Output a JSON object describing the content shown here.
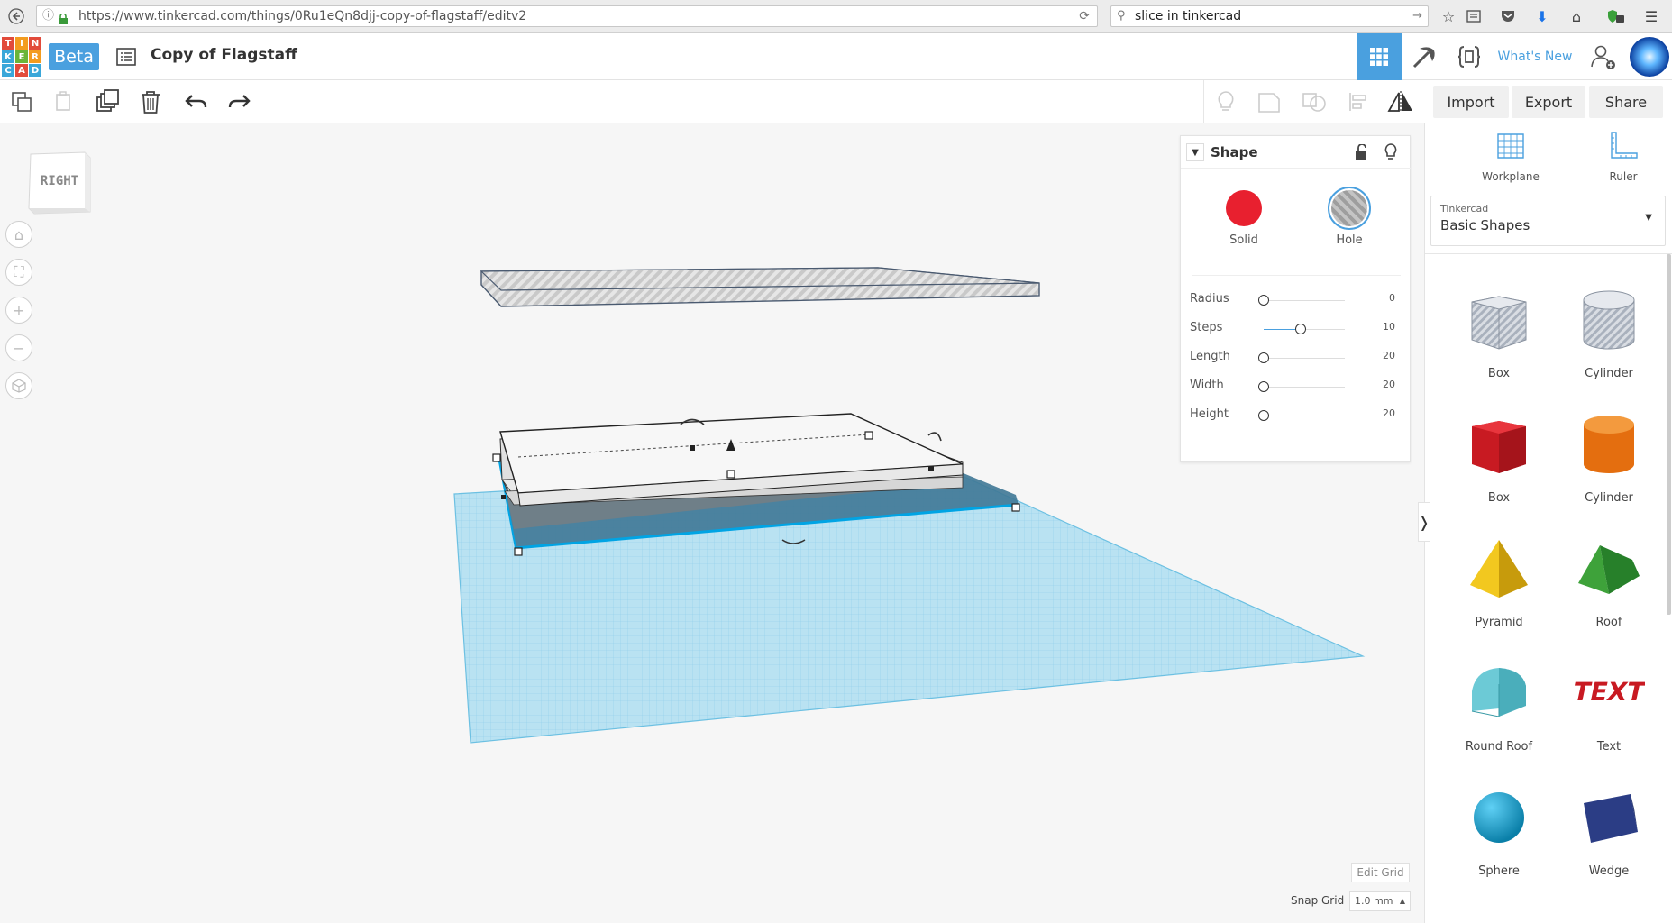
{
  "browser": {
    "url": "https://www.tinkercad.com/things/0Ru1eQn8djj-copy-of-flagstaff/editv2",
    "search": "slice in tinkercad"
  },
  "header": {
    "logo_letters": [
      "T",
      "I",
      "N",
      "K",
      "E",
      "R",
      "C",
      "A",
      "D"
    ],
    "beta_label": "Beta",
    "design_title": "Copy of Flagstaff",
    "whats_new": "What's New"
  },
  "toolbar": {
    "import_label": "Import",
    "export_label": "Export",
    "share_label": "Share"
  },
  "view_cube": {
    "label": "RIGHT"
  },
  "shape_panel": {
    "title": "Shape",
    "solid_label": "Solid",
    "hole_label": "Hole",
    "solid_color": "#e8202f",
    "properties": [
      {
        "label": "Radius",
        "value": "0",
        "level": 0.0
      },
      {
        "label": "Steps",
        "value": "10",
        "level": 0.45
      },
      {
        "label": "Length",
        "value": "20",
        "level": 0.0
      },
      {
        "label": "Width",
        "value": "20",
        "level": 0.0
      },
      {
        "label": "Height",
        "value": "20",
        "level": 0.0
      }
    ]
  },
  "right_panel": {
    "workplane_label": "Workplane",
    "ruler_label": "Ruler",
    "library_source": "Tinkercad",
    "library_name": "Basic Shapes",
    "shapes": [
      {
        "label": "Box",
        "icon": "box-hole-icon"
      },
      {
        "label": "Cylinder",
        "icon": "cylinder-hole-icon"
      },
      {
        "label": "Box",
        "icon": "box-red-icon"
      },
      {
        "label": "Cylinder",
        "icon": "cylinder-orange-icon"
      },
      {
        "label": "Pyramid",
        "icon": "pyramid-icon"
      },
      {
        "label": "Roof",
        "icon": "roof-icon"
      },
      {
        "label": "Round Roof",
        "icon": "round-roof-icon"
      },
      {
        "label": "Text",
        "icon": "text-shape-icon"
      },
      {
        "label": "Sphere",
        "icon": "sphere-icon"
      },
      {
        "label": "Wedge",
        "icon": "wedge-icon"
      }
    ]
  },
  "canvas": {
    "edit_grid_label": "Edit Grid",
    "snap_grid_label": "Snap Grid",
    "snap_grid_value": "1.0 mm"
  },
  "colors": {
    "accent": "#4aa0df",
    "workplane": "#a8d8ee",
    "selection": "#00a4e4"
  }
}
